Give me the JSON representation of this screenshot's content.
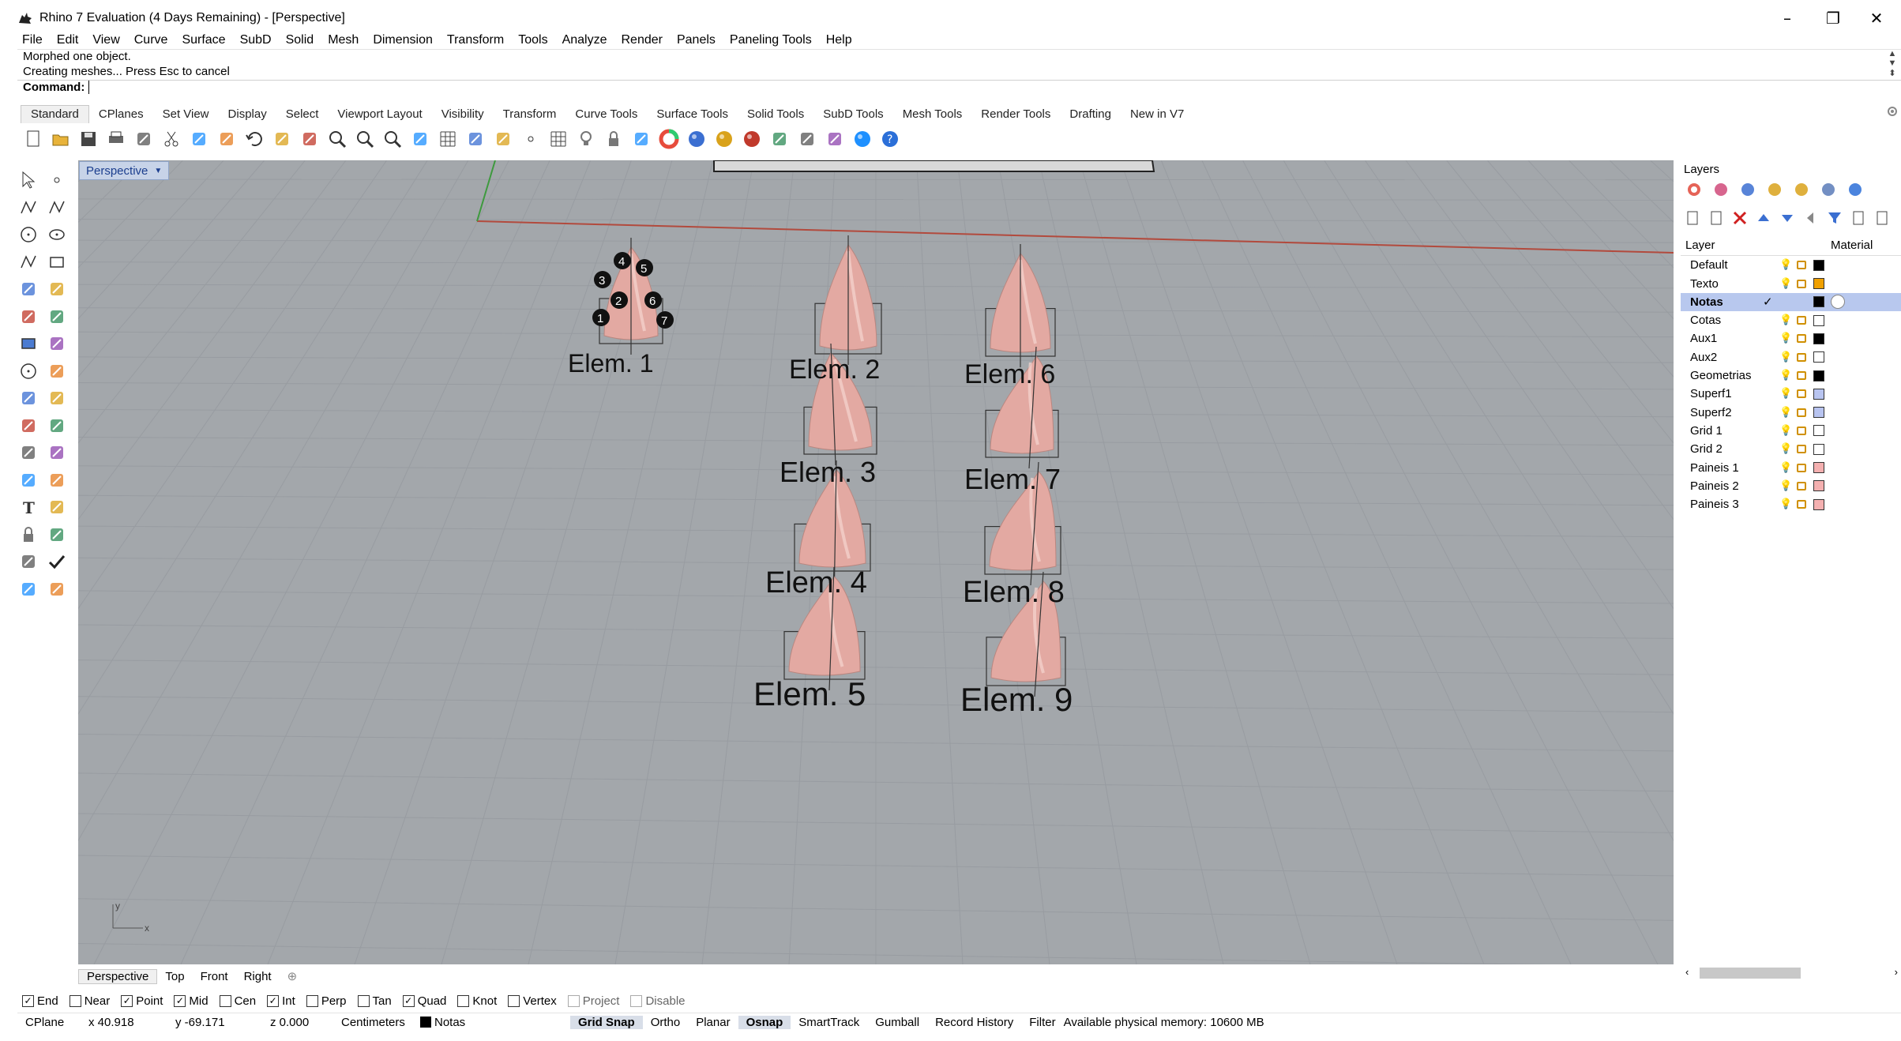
{
  "window": {
    "title": "Rhino 7 Evaluation (4 Days Remaining) - [Perspective]",
    "minimize": "–",
    "restore": "❐",
    "close": "✕"
  },
  "menu": [
    "File",
    "Edit",
    "View",
    "Curve",
    "Surface",
    "SubD",
    "Solid",
    "Mesh",
    "Dimension",
    "Transform",
    "Tools",
    "Analyze",
    "Render",
    "Panels",
    "Paneling Tools",
    "Help"
  ],
  "command": {
    "history": [
      "Morphed one object.",
      "Creating meshes... Press Esc to cancel"
    ],
    "prompt": "Command:"
  },
  "toolbar_tabs": [
    "Standard",
    "CPlanes",
    "Set View",
    "Display",
    "Select",
    "Viewport Layout",
    "Visibility",
    "Transform",
    "Curve Tools",
    "Surface Tools",
    "Solid Tools",
    "SubD Tools",
    "Mesh Tools",
    "Render Tools",
    "Drafting",
    "New in V7"
  ],
  "active_toolbar_tab": "Standard",
  "toolbar_icons": [
    "new-icon",
    "open-icon",
    "save-icon",
    "print-icon",
    "import-icon",
    "cut-icon",
    "copy-icon",
    "paste-icon",
    "undo-icon",
    "pan-icon",
    "move-view-icon",
    "zoom-icon",
    "zoom-extents-icon",
    "zoom-window-icon",
    "rotate-view-icon",
    "four-views-icon",
    "car-icon",
    "snap-icon",
    "point-icon",
    "grid-snap-icon",
    "light-icon",
    "lock-icon",
    "layer-icon",
    "color-wheel-icon",
    "shaded-icon",
    "rendered-icon",
    "render-sphere-icon",
    "analyze-icon",
    "options-icon",
    "tools-icon",
    "globe-icon",
    "help-icon"
  ],
  "left_tools": [
    "select-icon",
    "point-icon",
    "polyline-icon",
    "curve-icon",
    "circle-icon",
    "ellipse-icon",
    "arc-icon",
    "rectangle-icon",
    "polygon-icon",
    "freeform-icon",
    "surface-icon",
    "edge-icon",
    "solid-box-icon",
    "boolean-icon",
    "cylinder-icon",
    "extrude-icon",
    "mesh-icon",
    "transform-icon",
    "fillet-icon",
    "explode-icon",
    "rotate-icon",
    "scale-icon",
    "array-icon",
    "mirror-icon",
    "text-icon",
    "dimension-icon",
    "block-icon",
    "group-icon",
    "analyze-icon",
    "check-icon",
    "render-icon",
    "layer-tool-icon"
  ],
  "viewport": {
    "label": "Perspective",
    "elements": [
      "Elem. 1",
      "Elem. 2",
      "Elem. 3",
      "Elem. 4",
      "Elem. 5",
      "Elem. 6",
      "Elem. 7",
      "Elem. 8",
      "Elem. 9"
    ],
    "point_numbers": [
      "1",
      "2",
      "3",
      "4",
      "5",
      "6",
      "7"
    ],
    "axis_x": "x",
    "axis_y": "y",
    "colors": {
      "background": "#a3a7ab",
      "grid": "#949a9f",
      "shape": "#e3a9a2",
      "x_axis": "#b24a3d",
      "y_axis": "#3e9a3e"
    }
  },
  "viewport_tabs": [
    "Perspective",
    "Top",
    "Front",
    "Right"
  ],
  "osnaps": [
    {
      "label": "End",
      "checked": true,
      "enabled": true
    },
    {
      "label": "Near",
      "checked": false,
      "enabled": true
    },
    {
      "label": "Point",
      "checked": true,
      "enabled": true
    },
    {
      "label": "Mid",
      "checked": true,
      "enabled": true
    },
    {
      "label": "Cen",
      "checked": false,
      "enabled": true
    },
    {
      "label": "Int",
      "checked": true,
      "enabled": true
    },
    {
      "label": "Perp",
      "checked": false,
      "enabled": true
    },
    {
      "label": "Tan",
      "checked": false,
      "enabled": true
    },
    {
      "label": "Quad",
      "checked": true,
      "enabled": true
    },
    {
      "label": "Knot",
      "checked": false,
      "enabled": true
    },
    {
      "label": "Vertex",
      "checked": false,
      "enabled": true
    },
    {
      "label": "Project",
      "checked": false,
      "enabled": false
    },
    {
      "label": "Disable",
      "checked": false,
      "enabled": false
    }
  ],
  "status": {
    "cplane": "CPlane",
    "x": "x 40.918",
    "y": "y -69.171",
    "z": "z 0.000",
    "units": "Centimeters",
    "layer": "Notas",
    "grid_snap": "Grid Snap",
    "ortho": "Ortho",
    "planar": "Planar",
    "osnap": "Osnap",
    "smarttrack": "SmartTrack",
    "gumball": "Gumball",
    "record_history": "Record History",
    "filter": "Filter",
    "memory": "Available physical memory: 10600 MB"
  },
  "layers_panel": {
    "title": "Layers",
    "col_layer": "Layer",
    "col_material": "Material",
    "rows": [
      {
        "name": "Default",
        "color": "#000000",
        "current": false
      },
      {
        "name": "Texto",
        "color": "#f0a000",
        "current": false
      },
      {
        "name": "Notas",
        "color": "#000000",
        "current": true
      },
      {
        "name": "Cotas",
        "color": "#ffffff",
        "current": false
      },
      {
        "name": "Aux1",
        "color": "#000000",
        "current": false
      },
      {
        "name": "Aux2",
        "color": "#ffffff",
        "current": false
      },
      {
        "name": "Geometrias",
        "color": "#000000",
        "current": false
      },
      {
        "name": "Superf1",
        "color": "#b8c4f0",
        "current": false
      },
      {
        "name": "Superf2",
        "color": "#b8c4f0",
        "current": false
      },
      {
        "name": "Grid 1",
        "color": "#ffffff",
        "current": false
      },
      {
        "name": "Grid 2",
        "color": "#ffffff",
        "current": false
      },
      {
        "name": "Paineis 1",
        "color": "#f4b0b0",
        "current": false
      },
      {
        "name": "Paineis 2",
        "color": "#f4b0b0",
        "current": false
      },
      {
        "name": "Paineis 3",
        "color": "#f4b0b0",
        "current": false
      }
    ]
  }
}
